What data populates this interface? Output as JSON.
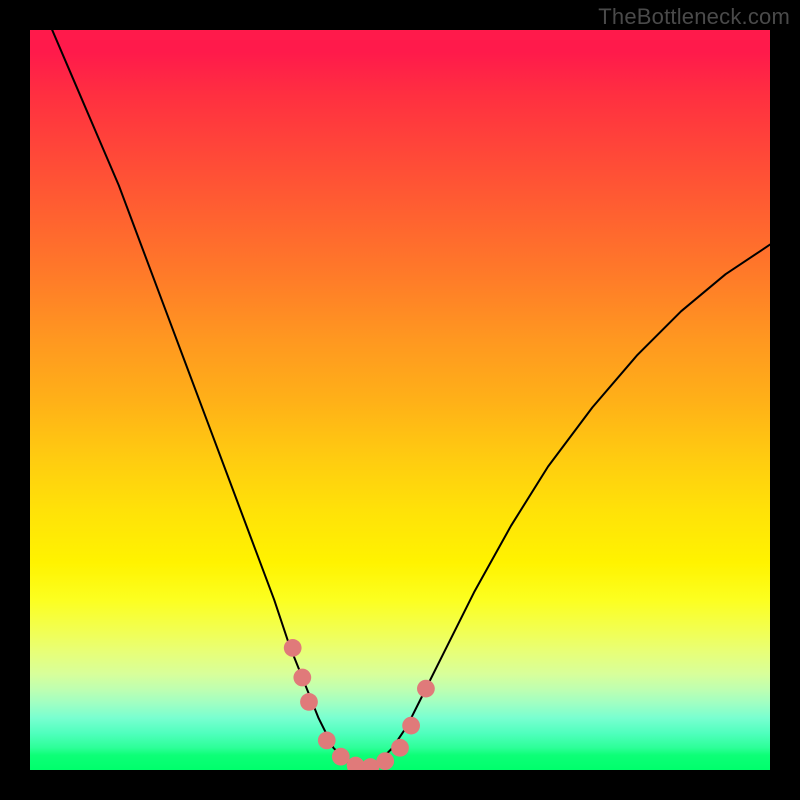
{
  "watermark": "TheBottleneck.com",
  "chart_data": {
    "type": "line",
    "title": "",
    "xlabel": "",
    "ylabel": "",
    "xlim": [
      0,
      100
    ],
    "ylim": [
      0,
      100
    ],
    "grid": false,
    "legend": false,
    "background_gradient": {
      "direction": "top-to-bottom",
      "stops": [
        {
          "pos": 0,
          "color": "#ff1a4b"
        },
        {
          "pos": 25,
          "color": "#ff6a2e"
        },
        {
          "pos": 50,
          "color": "#ffb018"
        },
        {
          "pos": 72,
          "color": "#fff300"
        },
        {
          "pos": 88,
          "color": "#c8ffa8"
        },
        {
          "pos": 100,
          "color": "#00ff6c"
        }
      ]
    },
    "series": [
      {
        "name": "bottleneck-curve",
        "color": "#000000",
        "stroke_width": 2,
        "x": [
          0,
          3,
          6,
          9,
          12,
          15,
          18,
          21,
          24,
          27,
          30,
          33,
          35,
          37,
          39,
          41,
          43,
          45,
          47,
          49,
          51,
          53,
          56,
          60,
          65,
          70,
          76,
          82,
          88,
          94,
          100
        ],
        "values": [
          106,
          100,
          93,
          86,
          79,
          71,
          63,
          55,
          47,
          39,
          31,
          23,
          17,
          12,
          7,
          3,
          1,
          0,
          1,
          3,
          6,
          10,
          16,
          24,
          33,
          41,
          49,
          56,
          62,
          67,
          71
        ]
      }
    ],
    "markers": [
      {
        "name": "point-a",
        "x": 35.5,
        "y": 16.5,
        "r": 1.2,
        "color": "#e07a7a"
      },
      {
        "name": "point-b",
        "x": 36.8,
        "y": 12.5,
        "r": 1.2,
        "color": "#e07a7a"
      },
      {
        "name": "point-c",
        "x": 37.7,
        "y": 9.2,
        "r": 1.2,
        "color": "#e07a7a"
      },
      {
        "name": "point-d",
        "x": 40.1,
        "y": 4.0,
        "r": 1.2,
        "color": "#e07a7a"
      },
      {
        "name": "point-e",
        "x": 42.0,
        "y": 1.8,
        "r": 1.2,
        "color": "#e07a7a"
      },
      {
        "name": "point-f",
        "x": 44.0,
        "y": 0.6,
        "r": 1.2,
        "color": "#e07a7a"
      },
      {
        "name": "point-g",
        "x": 46.0,
        "y": 0.4,
        "r": 1.2,
        "color": "#e07a7a"
      },
      {
        "name": "point-h",
        "x": 48.0,
        "y": 1.2,
        "r": 1.2,
        "color": "#e07a7a"
      },
      {
        "name": "point-i",
        "x": 50.0,
        "y": 3.0,
        "r": 1.2,
        "color": "#e07a7a"
      },
      {
        "name": "point-j",
        "x": 51.5,
        "y": 6.0,
        "r": 1.2,
        "color": "#e07a7a"
      },
      {
        "name": "point-k",
        "x": 53.5,
        "y": 11.0,
        "r": 1.2,
        "color": "#e07a7a"
      }
    ]
  }
}
